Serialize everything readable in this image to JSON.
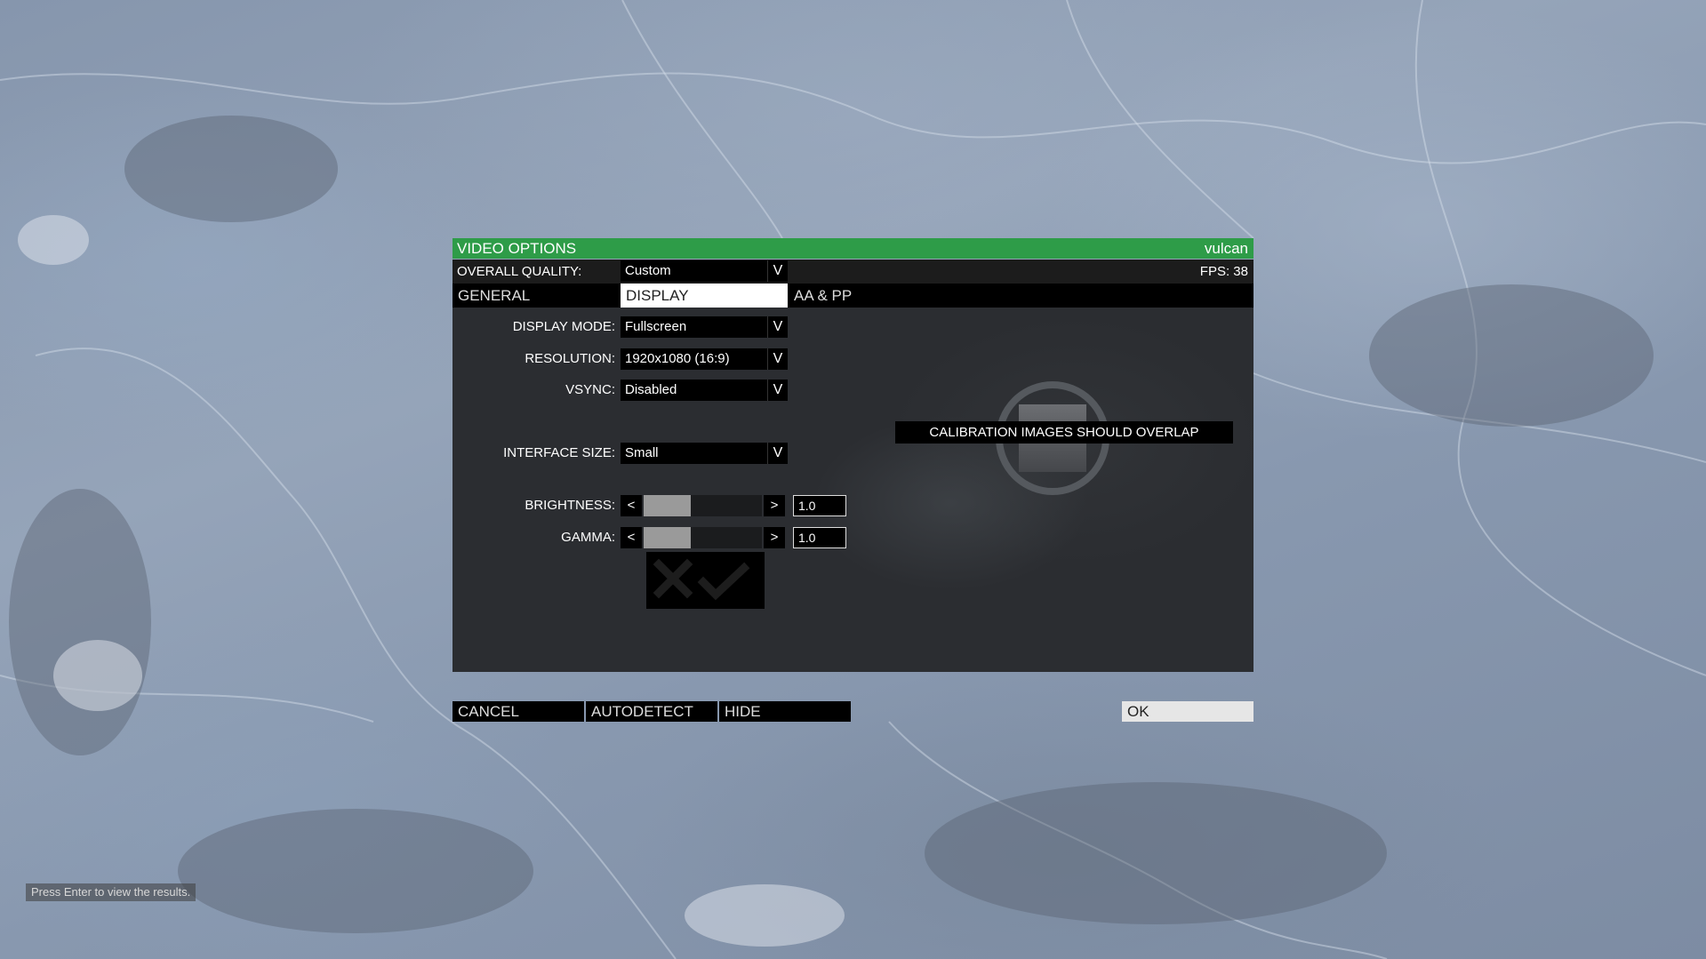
{
  "window": {
    "title": "VIDEO OPTIONS",
    "profile": "vulcan"
  },
  "quality": {
    "label": "OVERALL QUALITY:",
    "value": "Custom",
    "fps": "FPS: 38"
  },
  "tabs": [
    {
      "label": "GENERAL"
    },
    {
      "label": "DISPLAY",
      "active": true
    },
    {
      "label": "AA & PP"
    }
  ],
  "display": {
    "mode": {
      "label": "DISPLAY MODE:",
      "value": "Fullscreen"
    },
    "resolution": {
      "label": "RESOLUTION:",
      "value": "1920x1080 (16:9)"
    },
    "vsync": {
      "label": "VSYNC:",
      "value": "Disabled"
    },
    "interface_size": {
      "label": "INTERFACE SIZE:",
      "value": "Small"
    },
    "brightness": {
      "label": "BRIGHTNESS:",
      "value": "1.0",
      "level": 0.4
    },
    "gamma": {
      "label": "GAMMA:",
      "value": "1.0",
      "level": 0.4
    }
  },
  "dropdown_arrow": "V",
  "slider_prev": "<",
  "slider_next": ">",
  "calibration": {
    "text": "CALIBRATION IMAGES SHOULD OVERLAP"
  },
  "buttons": {
    "cancel": "CANCEL",
    "autodetect": "AUTODETECT",
    "hide": "HIDE",
    "ok": "OK"
  },
  "hint": "Press Enter to view the results.",
  "colors": {
    "accent": "#2e9c48",
    "panel": "#2b2d31"
  }
}
